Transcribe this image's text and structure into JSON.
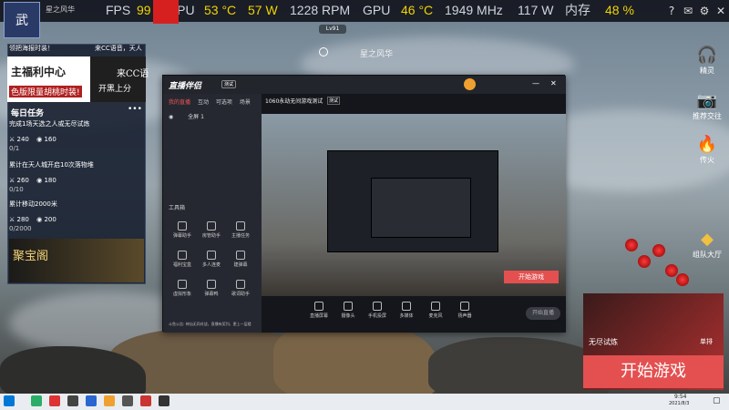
{
  "topbar": {
    "app_title": "星之风华",
    "fps_label": "FPS",
    "fps_value": "99",
    "cpu_label": "CPU",
    "cpu_temp": "53 °C",
    "cpu_power": "57 W",
    "cpu_rpm": "1228 RPM",
    "gpu_label": "GPU",
    "gpu_temp": "46 °C",
    "gpu_clock": "1949 MHz",
    "gpu_power": "117 W",
    "mem_label": "内存",
    "mem_value": "48 %",
    "level_badge": "Lv91",
    "location": "星之风华"
  },
  "left_panel": {
    "notice": "领把海报时装！",
    "notice2": "来CC语音，天人",
    "banner_title": "主福利中心",
    "banner_sub": "色版限量胡桃时装!",
    "banner_right": "来CC语",
    "banner_right_btn": "开黑上分",
    "daily_title": "每日任务",
    "tasks": [
      {
        "text": "完成1场天选之人或无尽试炼",
        "r1": "240",
        "r2": "160",
        "progress": "0/1"
      },
      {
        "text": "累计在天人城开启10次落物堆",
        "r1": "260",
        "r2": "180",
        "progress": "0/10"
      },
      {
        "text": "累计移动2000米",
        "r1": "280",
        "r2": "200",
        "progress": "0/2000"
      }
    ],
    "treasure": "聚宝阁"
  },
  "window": {
    "logo": "直播伴侣",
    "beta": "测试",
    "tabs": [
      "我的直播",
      "互动",
      "可选项",
      "场景"
    ],
    "scene_label": "全屏 1",
    "stream_title": "1060永劫无间游戏测试",
    "stream_tag": "测试",
    "tool_section": "工具箱",
    "tools": [
      "弹幕助手",
      "房管助手",
      "主播任务",
      "福利宝盒",
      "多人连麦",
      "建弹幕",
      "虚拟形象",
      "弹幕鸭",
      "歌词助手"
    ],
    "bottom_tools": [
      "直播屏幕",
      "摄像头",
      "手机投屏",
      "多媒体",
      "麦克风",
      "扬声器"
    ],
    "start_live": "开始直播",
    "footer": "斗鱼公告: 神仙无同对战，直播有奖列，更上一层楼",
    "preview_start": "开始游戏"
  },
  "right_sidebar": [
    {
      "label": "精灵",
      "icon": "headset-icon"
    },
    {
      "label": "推荐交往",
      "icon": "camera-icon"
    },
    {
      "label": "传火",
      "icon": "fire-icon"
    },
    {
      "label": "组队大厅",
      "icon": "team-icon"
    }
  ],
  "start_card": {
    "mode_label": "无尽试炼",
    "player_name": "单排",
    "button": "开始游戏"
  },
  "taskbar": {
    "time": "9:54",
    "date": "2021/8/3"
  }
}
